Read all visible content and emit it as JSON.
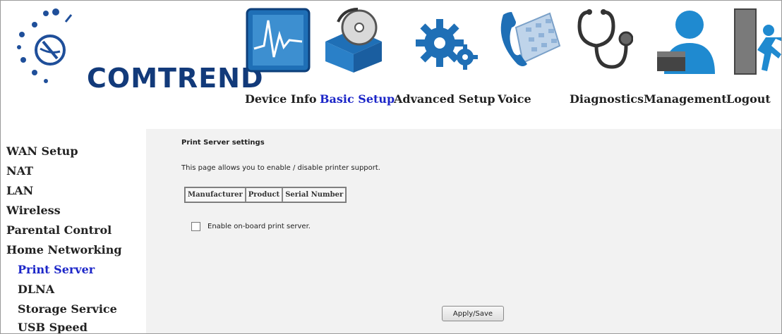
{
  "brand": {
    "name": "COMTREND"
  },
  "nav": {
    "items": [
      {
        "label": "Device Info",
        "icon": "device-info-chart-icon"
      },
      {
        "label": "Basic Setup",
        "icon": "basic-setup-disc-box-icon",
        "active": true
      },
      {
        "label": "Advanced Setup",
        "icon": "advanced-setup-gears-icon"
      },
      {
        "label": "Voice",
        "icon": "voice-phone-keypad-icon"
      },
      {
        "label": "Diagnostics",
        "icon": "diagnostics-stethoscope-icon"
      },
      {
        "label": "Management",
        "icon": "management-user-icon"
      },
      {
        "label": "Logout",
        "icon": "logout-exit-door-icon"
      }
    ]
  },
  "sidebar": {
    "items": [
      {
        "label": "WAN Setup"
      },
      {
        "label": "NAT"
      },
      {
        "label": "LAN"
      },
      {
        "label": "Wireless"
      },
      {
        "label": "Parental Control"
      },
      {
        "label": "Home Networking"
      },
      {
        "label": "Print Server",
        "active": true
      },
      {
        "label": "DLNA"
      },
      {
        "label": "Storage Service"
      },
      {
        "label": "USB Speed"
      }
    ]
  },
  "main": {
    "title": "Print Server settings",
    "description": "This page allows you to enable / disable printer support.",
    "table": {
      "headers": [
        "Manufacturer",
        "Product",
        "Serial Number"
      ]
    },
    "checkbox": {
      "label": "Enable on-board print server.",
      "checked": false
    },
    "apply_button": "Apply/Save"
  },
  "colors": {
    "brand": "#123a7a",
    "active_link": "#1c26c8",
    "content_bg": "#f2f2f2"
  }
}
